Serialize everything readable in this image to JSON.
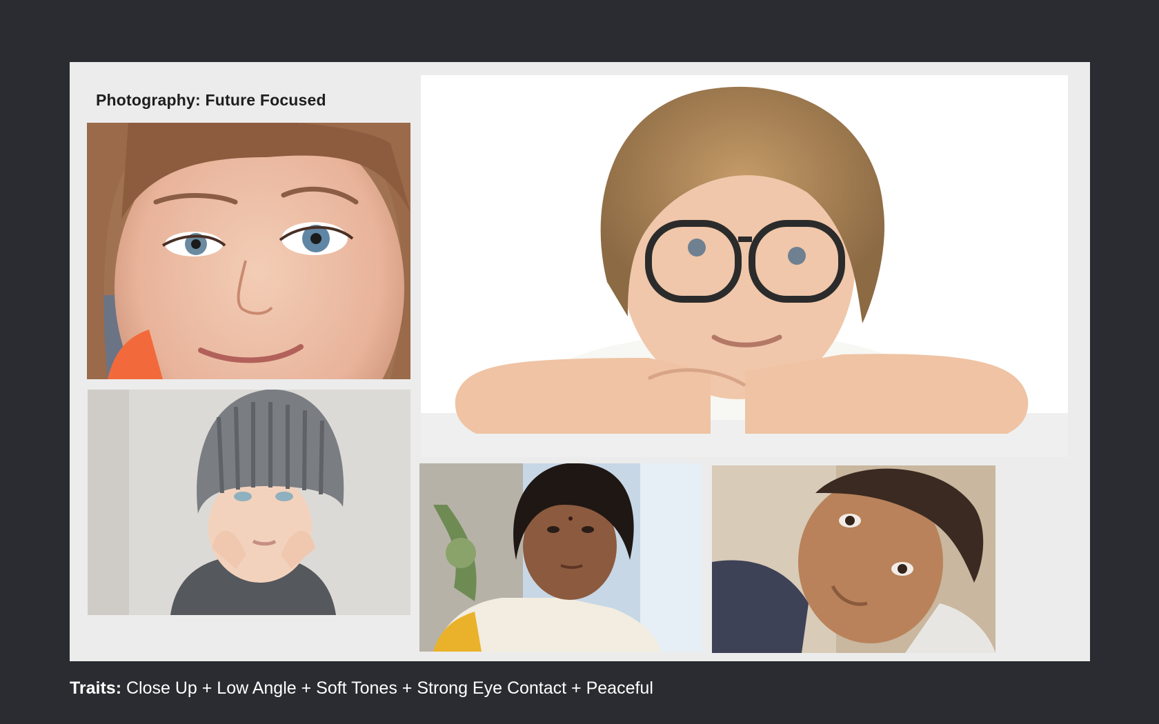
{
  "board": {
    "title": "Photography: Future Focused"
  },
  "photos": [
    {
      "name": "girl-closeup-photo",
      "subject": "young girl close-up, blue eyes, smiling"
    },
    {
      "name": "boy-glasses-photo",
      "subject": "blond boy with oversized glasses resting chin on arms"
    },
    {
      "name": "child-beanie-photo",
      "subject": "child in grey knit beanie with hands on cheeks"
    },
    {
      "name": "girl-wall-photo",
      "subject": "girl with short dark hair against blue wall"
    },
    {
      "name": "boy-lookup-photo",
      "subject": "boy looking up at the camera"
    }
  ],
  "traits": {
    "label": "Traits:",
    "text": "Close Up + Low Angle + Soft Tones + Strong Eye Contact + Peaceful"
  },
  "colors": {
    "background": "#2b2c31",
    "board": "#ececec",
    "title_text": "#1e1e1e",
    "caption_text": "#ffffff"
  }
}
